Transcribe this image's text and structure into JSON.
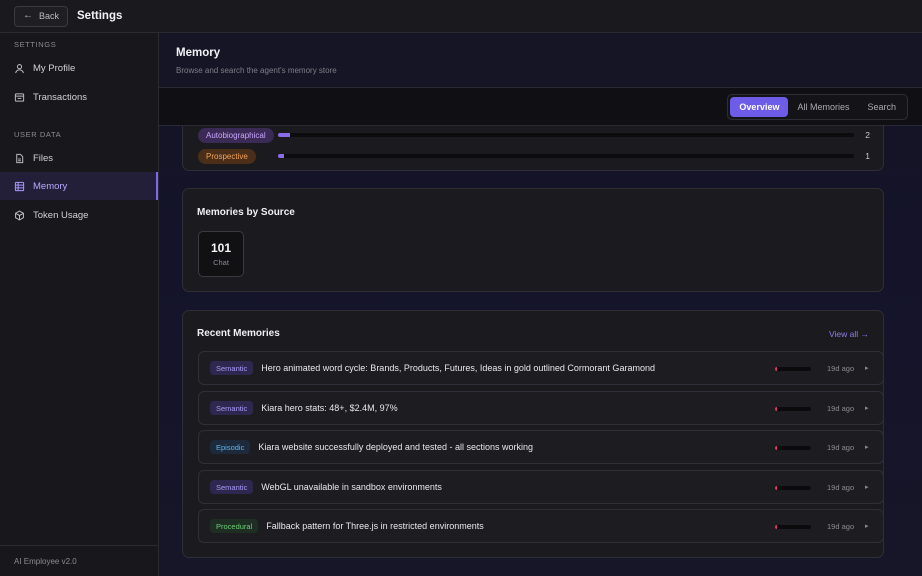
{
  "topbar": {
    "back_label": "Back",
    "title": "Settings"
  },
  "sidebar": {
    "section_settings": "SETTINGS",
    "section_user_data": "USER DATA",
    "items": [
      {
        "label": "My Profile",
        "icon": "user-icon"
      },
      {
        "label": "Transactions",
        "icon": "receipt-icon"
      },
      {
        "label": "Files",
        "icon": "file-icon"
      },
      {
        "label": "Memory",
        "icon": "memory-icon",
        "active": true
      },
      {
        "label": "Token Usage",
        "icon": "cube-icon"
      }
    ],
    "footer": "AI Employee v2.0"
  },
  "main": {
    "title": "Memory",
    "subtitle": "Browse and search the agent's memory store",
    "tabs": [
      {
        "label": "Overview",
        "active": true
      },
      {
        "label": "All Memories"
      },
      {
        "label": "Search"
      }
    ],
    "types": [
      {
        "label": "Autobiographical",
        "count": "2",
        "fraction": 0.02,
        "color": "#c9a7ff",
        "bg": "#3a2a55"
      },
      {
        "label": "Prospective",
        "count": "1",
        "fraction": 0.01,
        "color": "#f0a35c",
        "bg": "#4a2e18"
      }
    ],
    "source_card": {
      "title": "Memories by Source",
      "sources": [
        {
          "count": "101",
          "label": "Chat"
        }
      ]
    },
    "recent": {
      "title": "Recent Memories",
      "view_all": "View all →",
      "items": [
        {
          "type": "Semantic",
          "text": "Hero animated word cycle: Brands, Products, Futures, Ideas in gold outlined Cormorant Garamond",
          "time": "19d ago",
          "importance": 0.05
        },
        {
          "type": "Semantic",
          "text": "Kiara hero stats: 48+, $2.4M, 97%",
          "time": "19d ago",
          "importance": 0.05
        },
        {
          "type": "Episodic",
          "text": "Kiara website successfully deployed and tested - all sections working",
          "time": "19d ago",
          "importance": 0.05
        },
        {
          "type": "Semantic",
          "text": "WebGL unavailable in sandbox environments",
          "time": "19d ago",
          "importance": 0.05
        },
        {
          "type": "Procedural",
          "text": "Fallback pattern for Three.js in restricted environments",
          "time": "19d ago",
          "importance": 0.05
        }
      ]
    },
    "badge_colors": {
      "Semantic": {
        "fg": "#a89bf5",
        "bg": "#2e2850"
      },
      "Episodic": {
        "fg": "#5fb3f0",
        "bg": "#1d2a3c"
      },
      "Procedural": {
        "fg": "#6ccf7a",
        "bg": "#1f2e22"
      }
    },
    "accent": "#6c5ce7"
  }
}
